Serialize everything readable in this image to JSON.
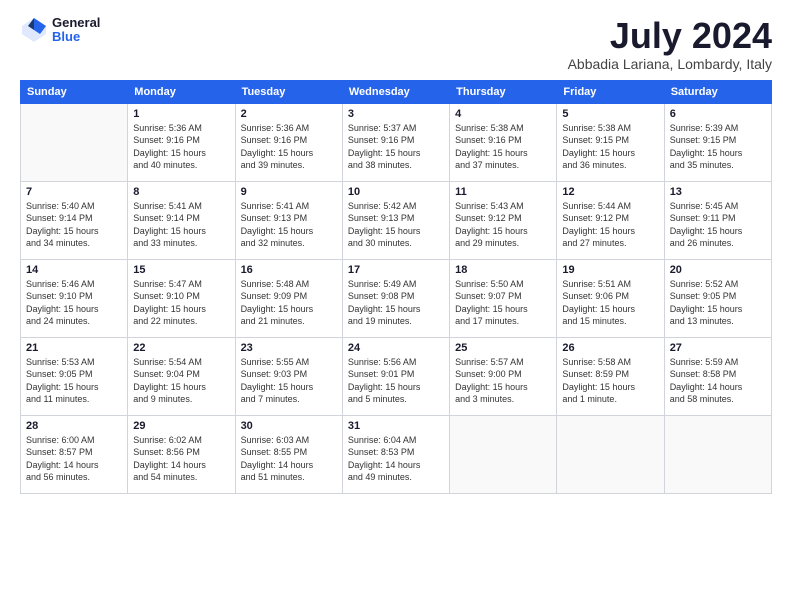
{
  "logo": {
    "general": "General",
    "blue": "Blue"
  },
  "title": "July 2024",
  "location": "Abbadia Lariana, Lombardy, Italy",
  "weekdays": [
    "Sunday",
    "Monday",
    "Tuesday",
    "Wednesday",
    "Thursday",
    "Friday",
    "Saturday"
  ],
  "rows": [
    [
      {
        "day": "",
        "info": ""
      },
      {
        "day": "1",
        "info": "Sunrise: 5:36 AM\nSunset: 9:16 PM\nDaylight: 15 hours\nand 40 minutes."
      },
      {
        "day": "2",
        "info": "Sunrise: 5:36 AM\nSunset: 9:16 PM\nDaylight: 15 hours\nand 39 minutes."
      },
      {
        "day": "3",
        "info": "Sunrise: 5:37 AM\nSunset: 9:16 PM\nDaylight: 15 hours\nand 38 minutes."
      },
      {
        "day": "4",
        "info": "Sunrise: 5:38 AM\nSunset: 9:16 PM\nDaylight: 15 hours\nand 37 minutes."
      },
      {
        "day": "5",
        "info": "Sunrise: 5:38 AM\nSunset: 9:15 PM\nDaylight: 15 hours\nand 36 minutes."
      },
      {
        "day": "6",
        "info": "Sunrise: 5:39 AM\nSunset: 9:15 PM\nDaylight: 15 hours\nand 35 minutes."
      }
    ],
    [
      {
        "day": "7",
        "info": "Sunrise: 5:40 AM\nSunset: 9:14 PM\nDaylight: 15 hours\nand 34 minutes."
      },
      {
        "day": "8",
        "info": "Sunrise: 5:41 AM\nSunset: 9:14 PM\nDaylight: 15 hours\nand 33 minutes."
      },
      {
        "day": "9",
        "info": "Sunrise: 5:41 AM\nSunset: 9:13 PM\nDaylight: 15 hours\nand 32 minutes."
      },
      {
        "day": "10",
        "info": "Sunrise: 5:42 AM\nSunset: 9:13 PM\nDaylight: 15 hours\nand 30 minutes."
      },
      {
        "day": "11",
        "info": "Sunrise: 5:43 AM\nSunset: 9:12 PM\nDaylight: 15 hours\nand 29 minutes."
      },
      {
        "day": "12",
        "info": "Sunrise: 5:44 AM\nSunset: 9:12 PM\nDaylight: 15 hours\nand 27 minutes."
      },
      {
        "day": "13",
        "info": "Sunrise: 5:45 AM\nSunset: 9:11 PM\nDaylight: 15 hours\nand 26 minutes."
      }
    ],
    [
      {
        "day": "14",
        "info": "Sunrise: 5:46 AM\nSunset: 9:10 PM\nDaylight: 15 hours\nand 24 minutes."
      },
      {
        "day": "15",
        "info": "Sunrise: 5:47 AM\nSunset: 9:10 PM\nDaylight: 15 hours\nand 22 minutes."
      },
      {
        "day": "16",
        "info": "Sunrise: 5:48 AM\nSunset: 9:09 PM\nDaylight: 15 hours\nand 21 minutes."
      },
      {
        "day": "17",
        "info": "Sunrise: 5:49 AM\nSunset: 9:08 PM\nDaylight: 15 hours\nand 19 minutes."
      },
      {
        "day": "18",
        "info": "Sunrise: 5:50 AM\nSunset: 9:07 PM\nDaylight: 15 hours\nand 17 minutes."
      },
      {
        "day": "19",
        "info": "Sunrise: 5:51 AM\nSunset: 9:06 PM\nDaylight: 15 hours\nand 15 minutes."
      },
      {
        "day": "20",
        "info": "Sunrise: 5:52 AM\nSunset: 9:05 PM\nDaylight: 15 hours\nand 13 minutes."
      }
    ],
    [
      {
        "day": "21",
        "info": "Sunrise: 5:53 AM\nSunset: 9:05 PM\nDaylight: 15 hours\nand 11 minutes."
      },
      {
        "day": "22",
        "info": "Sunrise: 5:54 AM\nSunset: 9:04 PM\nDaylight: 15 hours\nand 9 minutes."
      },
      {
        "day": "23",
        "info": "Sunrise: 5:55 AM\nSunset: 9:03 PM\nDaylight: 15 hours\nand 7 minutes."
      },
      {
        "day": "24",
        "info": "Sunrise: 5:56 AM\nSunset: 9:01 PM\nDaylight: 15 hours\nand 5 minutes."
      },
      {
        "day": "25",
        "info": "Sunrise: 5:57 AM\nSunset: 9:00 PM\nDaylight: 15 hours\nand 3 minutes."
      },
      {
        "day": "26",
        "info": "Sunrise: 5:58 AM\nSunset: 8:59 PM\nDaylight: 15 hours\nand 1 minute."
      },
      {
        "day": "27",
        "info": "Sunrise: 5:59 AM\nSunset: 8:58 PM\nDaylight: 14 hours\nand 58 minutes."
      }
    ],
    [
      {
        "day": "28",
        "info": "Sunrise: 6:00 AM\nSunset: 8:57 PM\nDaylight: 14 hours\nand 56 minutes."
      },
      {
        "day": "29",
        "info": "Sunrise: 6:02 AM\nSunset: 8:56 PM\nDaylight: 14 hours\nand 54 minutes."
      },
      {
        "day": "30",
        "info": "Sunrise: 6:03 AM\nSunset: 8:55 PM\nDaylight: 14 hours\nand 51 minutes."
      },
      {
        "day": "31",
        "info": "Sunrise: 6:04 AM\nSunset: 8:53 PM\nDaylight: 14 hours\nand 49 minutes."
      },
      {
        "day": "",
        "info": ""
      },
      {
        "day": "",
        "info": ""
      },
      {
        "day": "",
        "info": ""
      }
    ]
  ]
}
